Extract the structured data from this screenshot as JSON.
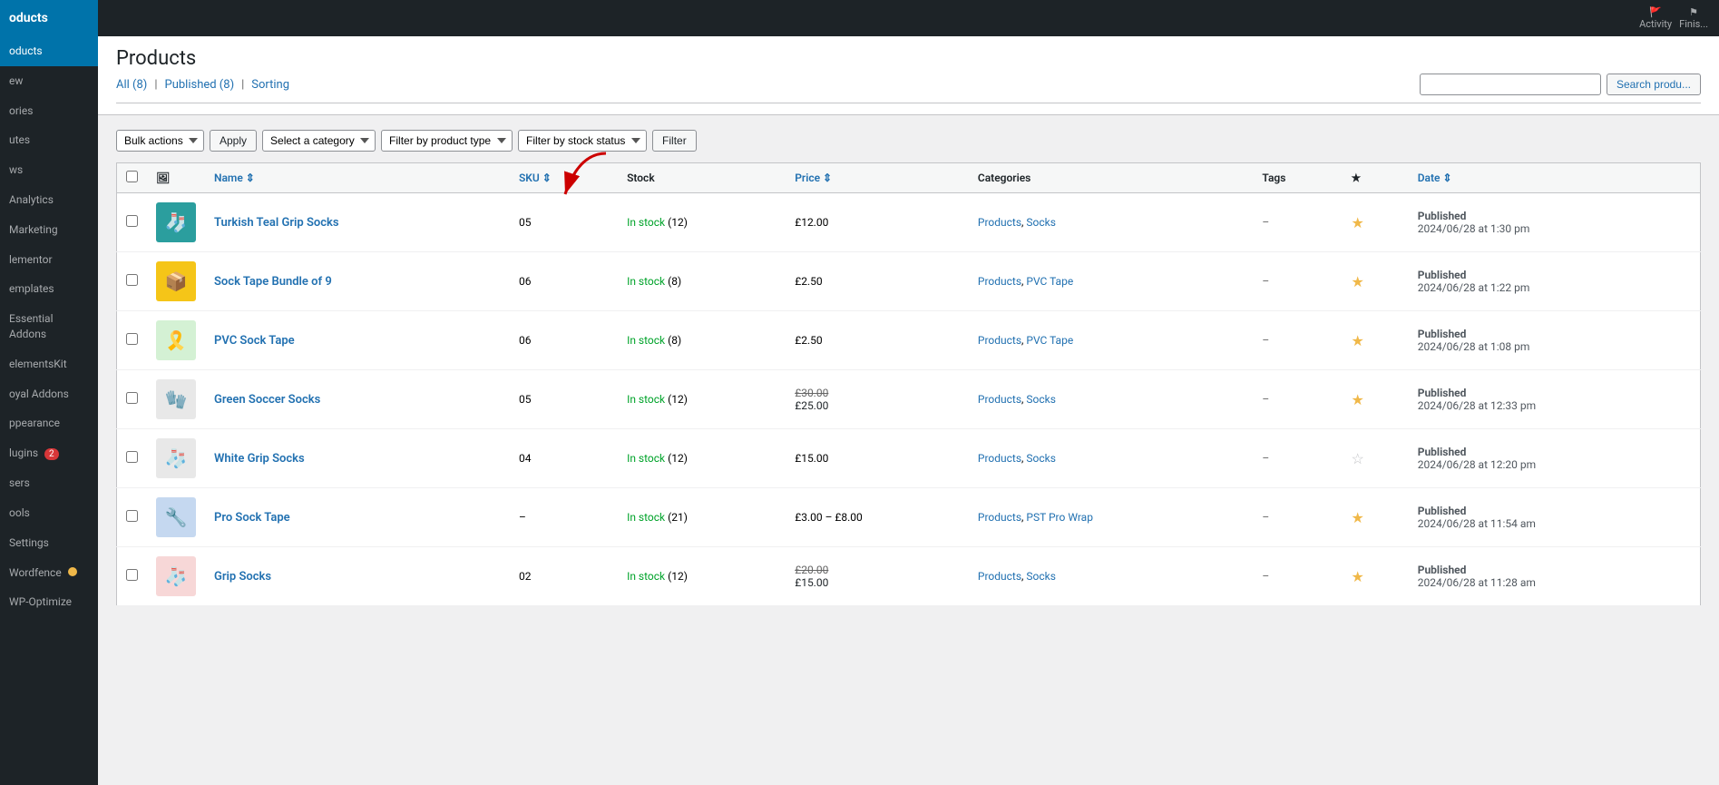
{
  "sidebar": {
    "logo": "oducts",
    "items": [
      {
        "label": "oducts",
        "active": true
      },
      {
        "label": "ew",
        "active": false
      },
      {
        "label": "ories",
        "active": false
      },
      {
        "label": "",
        "active": false
      },
      {
        "label": "utes",
        "active": false
      },
      {
        "label": "ws",
        "active": false
      },
      {
        "label": "Analytics",
        "active": false
      },
      {
        "label": "Marketing",
        "active": false
      },
      {
        "label": "lementor",
        "active": false
      },
      {
        "label": "emplates",
        "active": false
      },
      {
        "label": "Essential Addons",
        "active": false
      },
      {
        "label": "elementsKit",
        "active": false
      },
      {
        "label": "oyal Addons",
        "active": false
      },
      {
        "label": "ppearance",
        "active": false
      },
      {
        "label": "lugins",
        "active": false,
        "badge": "2"
      },
      {
        "label": "sers",
        "active": false
      },
      {
        "label": "ools",
        "active": false
      },
      {
        "label": "Settings",
        "active": false
      },
      {
        "label": "Wordfence",
        "active": false,
        "dot": true
      },
      {
        "label": "WP-Optimize",
        "active": false
      }
    ]
  },
  "topbar": {
    "activity_label": "Activity",
    "finish_label": "Finis..."
  },
  "page": {
    "title": "Products",
    "tabs": [
      {
        "label": "All",
        "count": "8"
      },
      {
        "label": "Published",
        "count": "8"
      },
      {
        "label": "Sorting"
      }
    ],
    "search_placeholder": "",
    "search_button": "Search produ..."
  },
  "filters": {
    "bulk_actions_label": "Bulk actions",
    "apply_label": "Apply",
    "category_label": "Select a category",
    "product_type_label": "Filter by product type",
    "stock_status_label": "Filter by stock status",
    "filter_label": "Filter"
  },
  "table": {
    "columns": [
      "",
      "",
      "Name",
      "SKU",
      "Stock",
      "Price",
      "Categories",
      "Tags",
      "★",
      "Date"
    ],
    "rows": [
      {
        "name": "Turkish Teal Grip Socks",
        "image_emoji": "🧦",
        "image_bg": "#2b9e9e",
        "sku": "05",
        "stock_status": "In stock",
        "stock_count": "(12)",
        "price": "£12.00",
        "price_sale": null,
        "categories": "Products, Socks",
        "tags": "–",
        "starred": true,
        "date_status": "Published",
        "date_value": "2024/06/28 at 1:30 pm"
      },
      {
        "name": "Sock Tape Bundle of 9",
        "image_emoji": "📦",
        "image_bg": "#f5c518",
        "sku": "06",
        "stock_status": "In stock",
        "stock_count": "(8)",
        "price": "£2.50",
        "price_sale": null,
        "categories": "Products, PVC Tape",
        "tags": "–",
        "starred": true,
        "date_status": "Published",
        "date_value": "2024/06/28 at 1:22 pm"
      },
      {
        "name": "PVC Sock Tape",
        "image_emoji": "🎗️",
        "image_bg": "#d4f1d4",
        "sku": "06",
        "stock_status": "In stock",
        "stock_count": "(8)",
        "price": "£2.50",
        "price_sale": null,
        "categories": "Products, PVC Tape",
        "tags": "–",
        "starred": true,
        "date_status": "Published",
        "date_value": "2024/06/28 at 1:08 pm"
      },
      {
        "name": "Green Soccer Socks",
        "image_emoji": "🧤",
        "image_bg": "#e8e8e8",
        "sku": "05",
        "stock_status": "In stock",
        "stock_count": "(12)",
        "price_strike": "£30.00",
        "price": "£25.00",
        "price_sale": null,
        "categories": "Products, Socks",
        "tags": "–",
        "starred": true,
        "date_status": "Published",
        "date_value": "2024/06/28 at 12:33 pm"
      },
      {
        "name": "White Grip Socks",
        "image_emoji": "🧦",
        "image_bg": "#e8e8e8",
        "sku": "04",
        "stock_status": "In stock",
        "stock_count": "(12)",
        "price": "£15.00",
        "price_sale": null,
        "categories": "Products, Socks",
        "tags": "–",
        "starred": false,
        "date_status": "Published",
        "date_value": "2024/06/28 at 12:20 pm"
      },
      {
        "name": "Pro Sock Tape",
        "image_emoji": "🔧",
        "image_bg": "#c5d8f0",
        "sku": "–",
        "stock_status": "In stock",
        "stock_count": "(21)",
        "price": "£3.00 – £8.00",
        "price_sale": null,
        "categories": "Products, PST Pro Wrap",
        "tags": "–",
        "starred": true,
        "date_status": "Published",
        "date_value": "2024/06/28 at 11:54 am"
      },
      {
        "name": "Grip Socks",
        "image_emoji": "🧦",
        "image_bg": "#f7d7d7",
        "sku": "02",
        "stock_status": "In stock",
        "stock_count": "(12)",
        "price_strike": "£20.00",
        "price": "£15.00",
        "price_sale": null,
        "categories": "Products, Socks",
        "tags": "–",
        "starred": true,
        "date_status": "Published",
        "date_value": "2024/06/28 at 11:28 am"
      }
    ]
  }
}
